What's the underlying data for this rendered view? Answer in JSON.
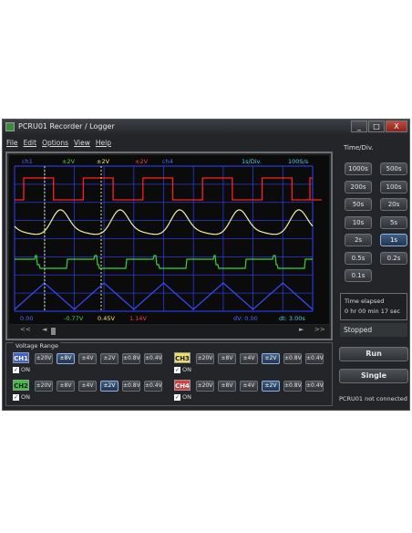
{
  "window": {
    "title": "PCRU01 Recorder / Logger",
    "minimize": "_",
    "maximize": "□",
    "close": "X"
  },
  "menu": [
    "File",
    "Edit",
    "Options",
    "View",
    "Help"
  ],
  "scope": {
    "top_labels": [
      {
        "text": "ch1",
        "color": "#4a6bff"
      },
      {
        "text": "±2V",
        "color": "#4cd14c"
      },
      {
        "text": "±2V",
        "color": "#f0f04a"
      },
      {
        "text": "±2V",
        "color": "#ff3b3b"
      },
      {
        "text": "ch4",
        "color": "#4a6bff"
      },
      {
        "text": "1s/Div.",
        "color": "#4ad0f0"
      },
      {
        "text": "100S/s",
        "color": "#4ad0f0"
      }
    ],
    "bottom_labels": [
      {
        "text": "0.00",
        "color": "#4a6bff"
      },
      {
        "text": "-0.77V",
        "color": "#4cd14c"
      },
      {
        "text": "0.45V",
        "color": "#f0f04a"
      },
      {
        "text": "1.14V",
        "color": "#ff3b3b"
      },
      {
        "text": "dV: 0.00",
        "color": "#4a6bff"
      },
      {
        "text": "dt: 3.00s",
        "color": "#4ad0f0"
      }
    ],
    "colors": {
      "grid": "#2a3bd6",
      "ch1": "#3a4bff",
      "ch2": "#36d436",
      "ch3": "#f2f2a0",
      "ch4": "#ff2020",
      "cursor": "#e8e86a"
    },
    "scroll": {
      "first": "<<",
      "prev": "◄",
      "next": "►",
      "last": ">>"
    }
  },
  "time_div": {
    "title": "Time/Div.",
    "buttons": [
      "1000s",
      "500s",
      "200s",
      "100s",
      "50s",
      "20s",
      "10s",
      "5s",
      "2s",
      "1s",
      "0.5s",
      "0.2s",
      "0.1s"
    ],
    "selected": "1s"
  },
  "elapsed": {
    "label": "Time elapsed",
    "value": "0 hr  00 min  17 sec"
  },
  "status": "Stopped",
  "voltage_range": {
    "title": "Voltage Range",
    "on_label": "ON",
    "options": [
      "±20V",
      "±8V",
      "±4V",
      "±2V",
      "±0.8V",
      "±0.4V"
    ],
    "channels": [
      {
        "name": "CH1",
        "color": "#3f5fd8",
        "text_color": "#ffffff",
        "selected": "±8V"
      },
      {
        "name": "CH2",
        "color": "#3fbf3f",
        "text_color": "#1a1a1a",
        "selected": "±2V"
      },
      {
        "name": "CH3",
        "color": "#e8e060",
        "text_color": "#1a1a1a",
        "selected": "±2V"
      },
      {
        "name": "CH4",
        "color": "#d84040",
        "text_color": "#ffffff",
        "selected": "±2V"
      }
    ]
  },
  "run_label": "Run",
  "single_label": "Single",
  "connection": "PCRU01 not connected"
}
